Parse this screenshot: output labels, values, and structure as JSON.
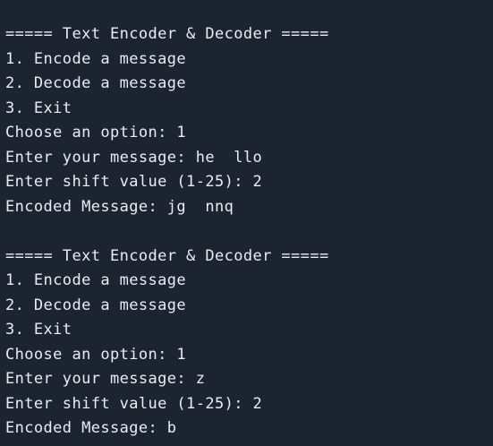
{
  "terminal": {
    "blocks": [
      {
        "header": "===== Text Encoder & Decoder =====",
        "menu": [
          "1. Encode a message",
          "2. Decode a message",
          "3. Exit"
        ],
        "choose": "Choose an option: 1",
        "message": "Enter your message: he  llo",
        "shift": "Enter shift value (1-25): 2",
        "result": "Encoded Message: jg  nnq"
      },
      {
        "header": "===== Text Encoder & Decoder =====",
        "menu": [
          "1. Encode a message",
          "2. Decode a message",
          "3. Exit"
        ],
        "choose": "Choose an option: 1",
        "message": "Enter your message: z",
        "shift": "Enter shift value (1-25): 2",
        "result": "Encoded Message: b"
      }
    ]
  }
}
